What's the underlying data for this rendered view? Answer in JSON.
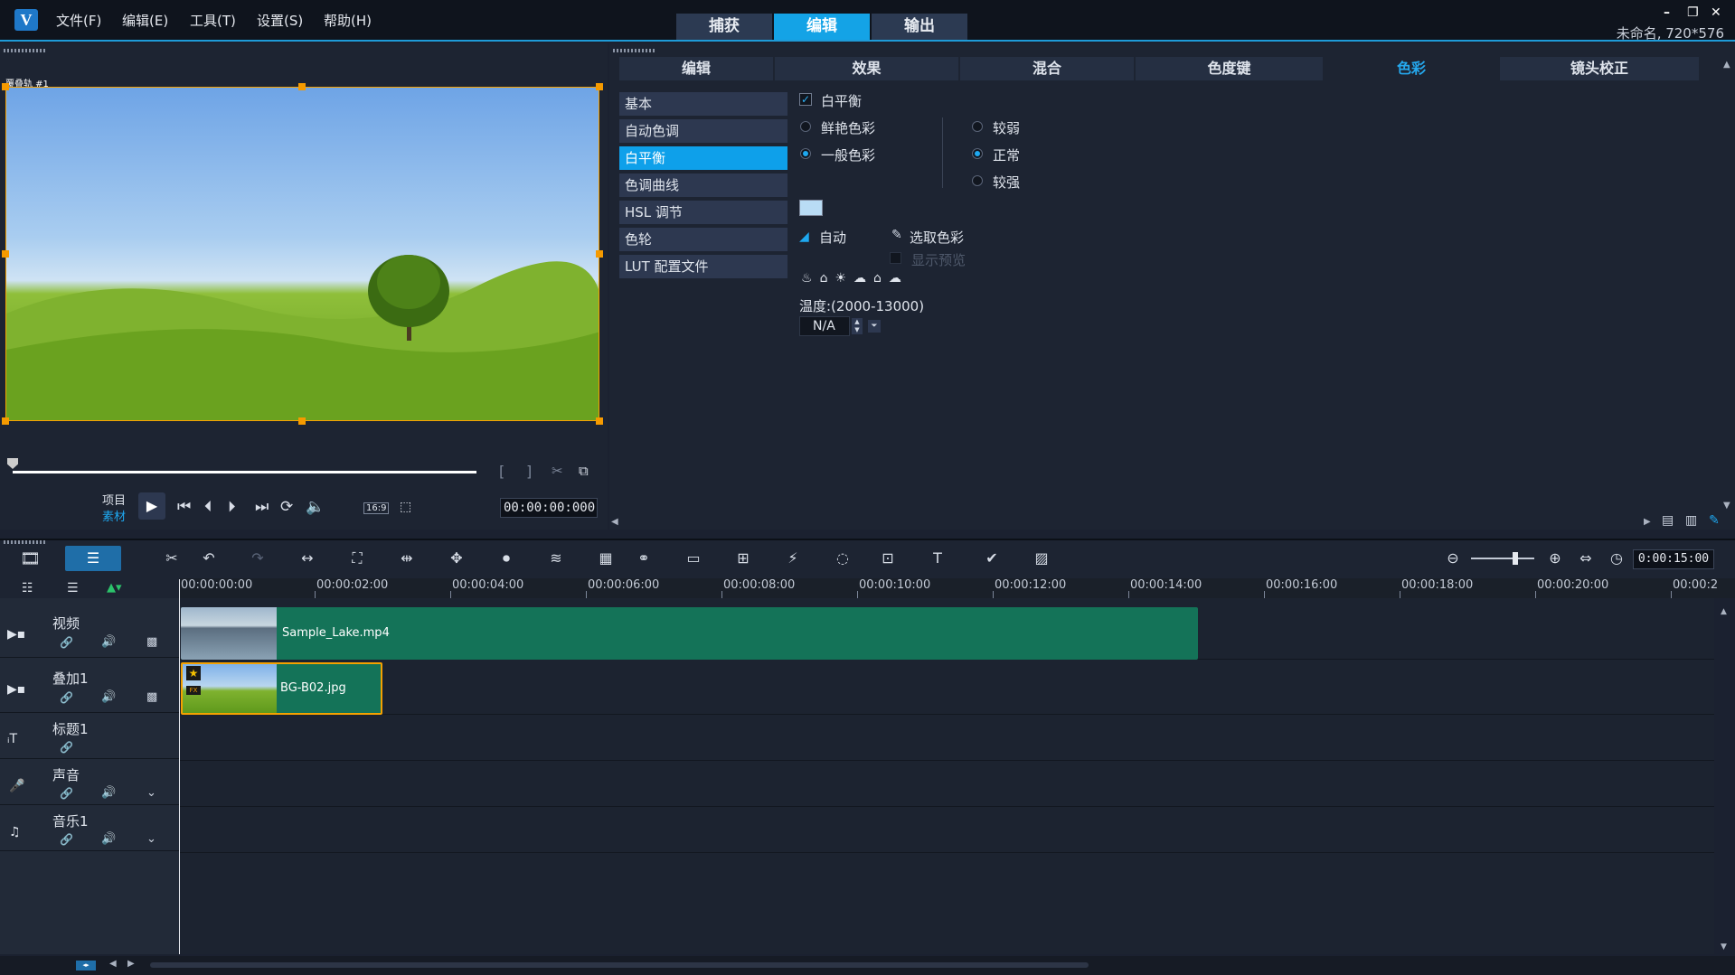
{
  "app": {
    "logo_letter": "V",
    "menus": [
      "文件(F)",
      "编辑(E)",
      "工具(T)",
      "设置(S)",
      "帮助(H)"
    ],
    "modes": [
      "捕获",
      "编辑",
      "输出"
    ],
    "active_mode": "编辑",
    "project_info": "未命名, 720*576"
  },
  "preview": {
    "track_label": "覆叠轨 #1",
    "mode_project": "项目",
    "mode_clip": "素材",
    "aspect": "16:9",
    "timecode": "00:00:00:000"
  },
  "options": {
    "tabs": [
      "编辑",
      "效果",
      "混合",
      "色度键",
      "色彩",
      "镜头校正"
    ],
    "active_tab": "色彩",
    "side_items": [
      "基本",
      "自动色调",
      "白平衡",
      "色调曲线",
      "HSL 调节",
      "色轮",
      "LUT 配置文件"
    ],
    "active_side": "白平衡",
    "white_balance_label": "白平衡",
    "color_mode_options": [
      "鲜艳色彩",
      "一般色彩"
    ],
    "color_mode_selected": "一般色彩",
    "strength_options": [
      "较弱",
      "正常",
      "较强"
    ],
    "strength_selected": "正常",
    "auto_label": "自动",
    "pick_color_label": "选取色彩",
    "show_preview_label": "显示预览",
    "temperature_label": "温度:(2000-13000)",
    "temperature_value": "N/A",
    "swatch_color": "#b9dcf5"
  },
  "timeline": {
    "zoom_time": "0:00:15:00",
    "ruler_ticks": [
      "00:00:00:00",
      "00:00:02:00",
      "00:00:04:00",
      "00:00:06:00",
      "00:00:08:00",
      "00:00:10:00",
      "00:00:12:00",
      "00:00:14:00",
      "00:00:16:00",
      "00:00:18:00",
      "00:00:20:00",
      "00:00:2"
    ],
    "tracks": [
      {
        "name": "视频",
        "clip": "Sample_Lake.mp4"
      },
      {
        "name": "叠加1",
        "clip": "BG-B02.jpg"
      },
      {
        "name": "标题1",
        "clip": ""
      },
      {
        "name": "声音",
        "clip": ""
      },
      {
        "name": "音乐1",
        "clip": ""
      }
    ]
  },
  "colors": {
    "accent": "#14a3e6",
    "clip": "#147358",
    "selection": "#f5a100"
  }
}
